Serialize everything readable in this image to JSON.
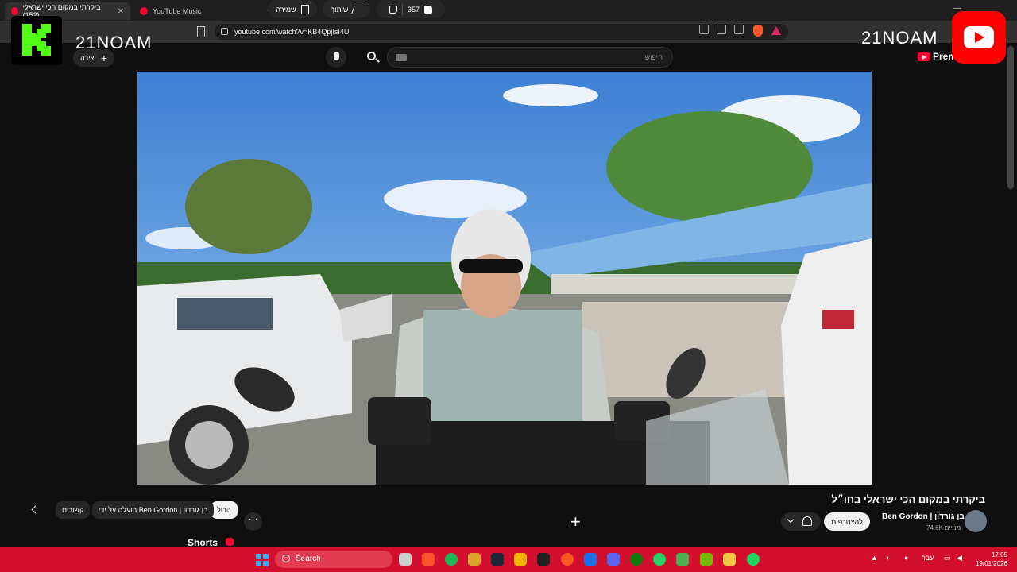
{
  "browser": {
    "tabs": [
      {
        "title": "ביקרתי במקום הכי ישראלי (152)",
        "active": true
      },
      {
        "title": "YouTube Music",
        "active": false
      }
    ],
    "new_tab": "+",
    "url": "youtube.com/watch?v=KB4QpjIsI4U"
  },
  "youtube": {
    "search_placeholder": "חיפוש",
    "create_label": "יצירה",
    "premium_label": "Prem"
  },
  "overlay": {
    "channel_name_left": "21NOAM",
    "channel_name_right": "21NOAM"
  },
  "video": {
    "title": "ביקרתי במקום הכי ישראלי בחו״ל",
    "channel": "Ben Gordon | בן גורדון",
    "subscribers": "74.6K מנויים",
    "subscribe_label": "להצטרפות",
    "likes": "357",
    "share_label": "שיתוף",
    "save_label": "שמירה"
  },
  "chips": [
    "הכול",
    "הועלה על ידי Ben Gordon | בן גורדון",
    "קשורים"
  ],
  "shorts_label": "Shorts",
  "taskbar": {
    "search_label": "Search",
    "language": "עבר",
    "time": "17:05",
    "date": "19/01/2026"
  },
  "colors": {
    "youtube_red": "#ff0033",
    "taskbar": "#d2102d",
    "k_logo_green": "#53fc18"
  }
}
